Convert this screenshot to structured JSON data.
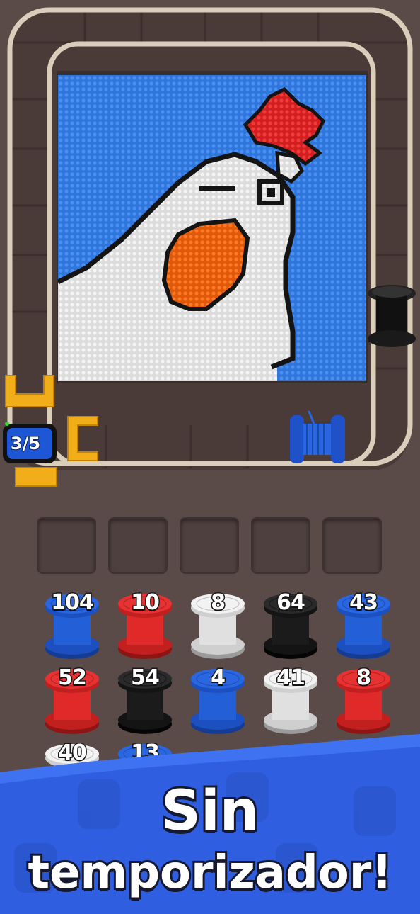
{
  "game": {
    "progress_text": "3/5",
    "progress_fraction": 0.6
  },
  "queue_slots": 5,
  "spools": [
    {
      "count": "104",
      "color": "blue"
    },
    {
      "count": "10",
      "color": "red"
    },
    {
      "count": "8",
      "color": "white"
    },
    {
      "count": "64",
      "color": "black"
    },
    {
      "count": "43",
      "color": "blue"
    },
    {
      "count": "52",
      "color": "red"
    },
    {
      "count": "54",
      "color": "black"
    },
    {
      "count": "4",
      "color": "blue"
    },
    {
      "count": "41",
      "color": "white"
    },
    {
      "count": "8",
      "color": "red"
    },
    {
      "count": "40",
      "color": "white"
    },
    {
      "count": "13",
      "color": "blue"
    }
  ],
  "banner": {
    "line1": "Sin",
    "line2": "temporizador!"
  },
  "colors": {
    "blue": "#1f5fd6",
    "red": "#e02a2a",
    "white": "#e9e9e9",
    "black": "#1b1b1b",
    "orange": "#f06a12",
    "board_bg": "#2f7ae0",
    "frame": "#e6dccb",
    "yellow": "#f5b21a",
    "banner": "#2f5fe0"
  }
}
